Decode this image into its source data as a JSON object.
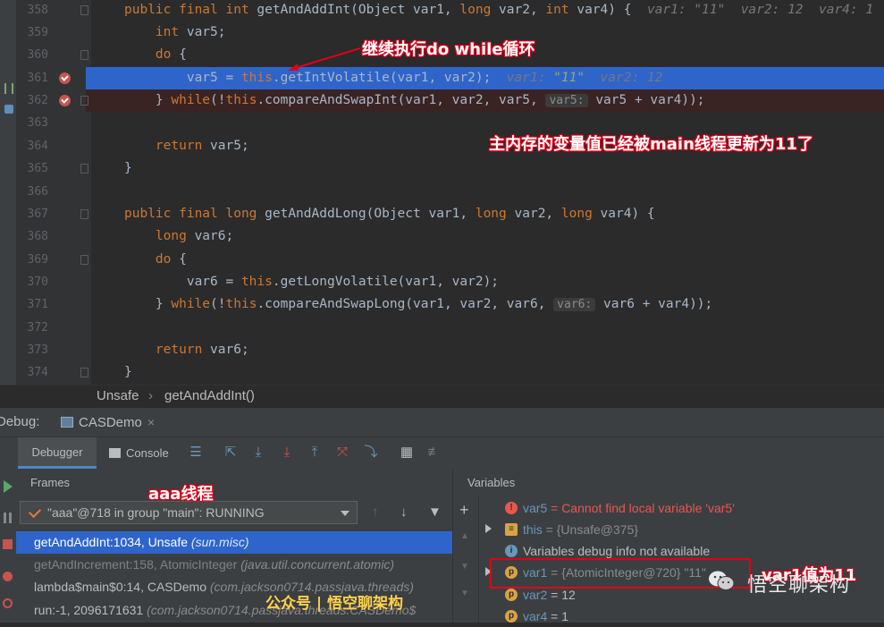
{
  "editor": {
    "lines": [
      {
        "num": "358",
        "parts": [
          [
            "kw",
            "public final int "
          ],
          [
            "plain",
            "getAndAddInt(Object var1, "
          ],
          [
            "kw",
            "long "
          ],
          [
            "plain",
            "var2, "
          ],
          [
            "kw",
            "int "
          ],
          [
            "plain",
            "var4) {  "
          ],
          [
            "hint",
            "var1: \"11\"  var2: 12  var4: 1"
          ]
        ]
      },
      {
        "num": "359",
        "parts": [
          [
            "plain",
            "    "
          ],
          [
            "kw",
            "int "
          ],
          [
            "plain",
            "var5;"
          ]
        ]
      },
      {
        "num": "360",
        "parts": [
          [
            "plain",
            "    "
          ],
          [
            "kw",
            "do "
          ],
          [
            "plain",
            "{"
          ]
        ]
      },
      {
        "num": "361",
        "parts": [
          [
            "plain",
            "        var5 = "
          ],
          [
            "kw",
            "this"
          ],
          [
            "plain",
            ".getIntVolatile(var1, var2);  "
          ],
          [
            "hint",
            "var1: "
          ],
          [
            "hintstr",
            "\"11\""
          ],
          [
            "hint",
            "  var2: 12"
          ]
        ]
      },
      {
        "num": "362",
        "parts": [
          [
            "plain",
            "    } "
          ],
          [
            "kw",
            "while"
          ],
          [
            "plain",
            "(!"
          ],
          [
            "kw",
            "this"
          ],
          [
            "plain",
            ".compareAndSwapInt(var1, var2, var5, "
          ],
          [
            "inlay",
            "var5:"
          ],
          [
            "plain",
            " var5 + var4));"
          ]
        ]
      },
      {
        "num": "363",
        "parts": []
      },
      {
        "num": "364",
        "parts": [
          [
            "plain",
            "    "
          ],
          [
            "kw",
            "return "
          ],
          [
            "plain",
            "var5;"
          ]
        ]
      },
      {
        "num": "365",
        "parts": [
          [
            "plain",
            "}"
          ]
        ]
      },
      {
        "num": "366",
        "parts": []
      },
      {
        "num": "367",
        "parts": [
          [
            "kw",
            "public final long "
          ],
          [
            "plain",
            "getAndAddLong(Object var1, "
          ],
          [
            "kw",
            "long "
          ],
          [
            "plain",
            "var2, "
          ],
          [
            "kw",
            "long "
          ],
          [
            "plain",
            "var4) {"
          ]
        ]
      },
      {
        "num": "368",
        "parts": [
          [
            "plain",
            "    "
          ],
          [
            "kw",
            "long "
          ],
          [
            "plain",
            "var6;"
          ]
        ]
      },
      {
        "num": "369",
        "parts": [
          [
            "plain",
            "    "
          ],
          [
            "kw",
            "do "
          ],
          [
            "plain",
            "{"
          ]
        ]
      },
      {
        "num": "370",
        "parts": [
          [
            "plain",
            "        var6 = "
          ],
          [
            "kw",
            "this"
          ],
          [
            "plain",
            ".getLongVolatile(var1, var2);"
          ]
        ]
      },
      {
        "num": "371",
        "parts": [
          [
            "plain",
            "    } "
          ],
          [
            "kw",
            "while"
          ],
          [
            "plain",
            "(!"
          ],
          [
            "kw",
            "this"
          ],
          [
            "plain",
            ".compareAndSwapLong(var1, var2, var6, "
          ],
          [
            "inlay",
            "var6:"
          ],
          [
            "plain",
            " var6 + var4));"
          ]
        ]
      },
      {
        "num": "372",
        "parts": []
      },
      {
        "num": "373",
        "parts": [
          [
            "plain",
            "    "
          ],
          [
            "kw",
            "return "
          ],
          [
            "plain",
            "var6;"
          ]
        ]
      },
      {
        "num": "374",
        "parts": [
          [
            "plain",
            "}"
          ]
        ]
      }
    ]
  },
  "annotations": {
    "loop": "继续执行do while循环",
    "main_updated": "主内存的变量值已经被main线程更新为11了",
    "thread": "aaa线程",
    "var1": "var1值为11"
  },
  "breadcrumb": {
    "class": "Unsafe",
    "sep": "›",
    "method": "getAndAddInt()"
  },
  "debug": {
    "label": "Debug:",
    "config": "CASDemo",
    "close": "×",
    "tabs": {
      "debugger": "Debugger",
      "console": "Console"
    },
    "frames_title": "Frames",
    "variables_title": "Variables",
    "thread_select": "\"aaa\"@718 in group \"main\": RUNNING",
    "frames": [
      {
        "method": "getAndAddInt:1034, Unsafe ",
        "pkg": "(sun.misc)"
      },
      {
        "method": "getAndIncrement:158, AtomicInteger ",
        "pkg": "(java.util.concurrent.atomic)"
      },
      {
        "method": "lambda$main$0:14, CASDemo ",
        "pkg": "(com.jackson0714.passjava.threads)"
      },
      {
        "method": "run:-1, 2096171631 ",
        "pkg": "(com.jackson0714.passjava.threads.CASDemo$"
      }
    ],
    "variables": [
      {
        "name": "var5",
        "value": " = Cannot find local variable 'var5'"
      },
      {
        "name": "this",
        "value": " = {Unsafe@375}"
      },
      {
        "name": "",
        "value": "Variables debug info not available"
      },
      {
        "name": "var1",
        "value": " = {AtomicInteger@720} \"11\""
      },
      {
        "name": "var2",
        "value": " = 12"
      },
      {
        "name": "var4",
        "value": " = 1"
      }
    ]
  },
  "watermark": {
    "left": "公众号 | 悟空聊架构",
    "right": "悟空聊架构"
  },
  "colors": {
    "accent": "#2f65ca",
    "annotation_red": "#e0001a",
    "keyword": "#cc7832",
    "breakpoint": "#c75450"
  }
}
